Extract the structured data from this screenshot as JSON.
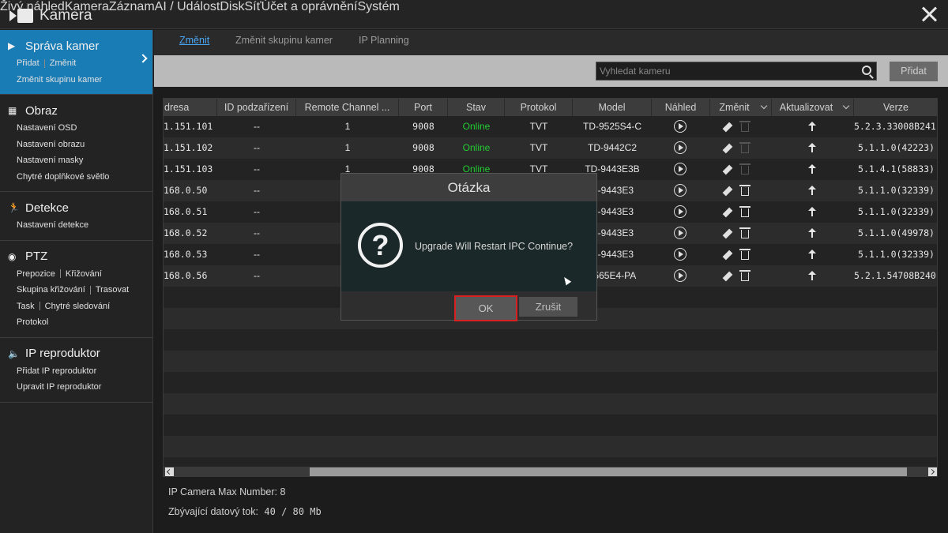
{
  "app": {
    "title": "Kamera"
  },
  "topnav": {
    "items": [
      "Živý náhled",
      "Kamera",
      "Záznam",
      "AI / Událost",
      "Disk",
      "Síť",
      "Účet a oprávnění",
      "Systém"
    ],
    "active_index": 1
  },
  "sidebar": {
    "sections": [
      {
        "title": "Správa kamer",
        "icon": "camera-icon",
        "lines": [
          [
            "Přidat",
            "Změnit"
          ],
          [
            "Změnit skupinu kamer"
          ]
        ]
      },
      {
        "title": "Obraz",
        "icon": "image-icon",
        "lines": [
          [
            "Nastavení OSD"
          ],
          [
            "Nastavení obrazu"
          ],
          [
            "Nastavení masky"
          ],
          [
            "Chytré doplňkové světlo"
          ]
        ]
      },
      {
        "title": "Detekce",
        "icon": "running-person-icon",
        "lines": [
          [
            "Nastavení detekce"
          ]
        ]
      },
      {
        "title": "PTZ",
        "icon": "ptz-dome-icon",
        "lines": [
          [
            "Prepozice",
            "Křižování"
          ],
          [
            "Skupina křižování",
            "Trasovat"
          ],
          [
            "Task",
            "Chytré sledování"
          ],
          [
            "Protokol"
          ]
        ]
      },
      {
        "title": "IP reproduktor",
        "icon": "speaker-icon",
        "lines": [
          [
            "Přidat IP reproduktor"
          ],
          [
            "Upravit IP reproduktor"
          ]
        ]
      }
    ]
  },
  "subtabs": [
    "Změnit",
    "Změnit skupinu kamer",
    "IP Planning"
  ],
  "search": {
    "placeholder": "Vyhledat kameru"
  },
  "add_button": "Přidat",
  "table": {
    "columns": [
      "dresa",
      "ID podzařízení",
      "Remote Channel ...",
      "Port",
      "Stav",
      "Protokol",
      "Model",
      "Náhled",
      "Změnit",
      "Aktualizovat",
      "Verze"
    ],
    "rows": [
      {
        "address": "1.151.101",
        "sub_id": "--",
        "channel": "1",
        "port": "9008",
        "status": "Online",
        "protocol": "TVT",
        "model": "TD-9525S4-C",
        "version": "5.2.3.33008B241...",
        "trash_enabled": false
      },
      {
        "address": "1.151.102",
        "sub_id": "--",
        "channel": "1",
        "port": "9008",
        "status": "Online",
        "protocol": "TVT",
        "model": "TD-9442C2",
        "version": "5.1.1.0(42223)",
        "trash_enabled": false
      },
      {
        "address": "1.151.103",
        "sub_id": "--",
        "channel": "1",
        "port": "9008",
        "status": "Online",
        "protocol": "TVT",
        "model": "TD-9443E3B",
        "version": "5.1.4.1(58833)",
        "trash_enabled": false
      },
      {
        "address": "168.0.50",
        "sub_id": "--",
        "channel": "",
        "port": "",
        "status": "",
        "protocol": "",
        "model": "D-9443E3",
        "version": "5.1.1.0(32339)",
        "trash_enabled": true
      },
      {
        "address": "168.0.51",
        "sub_id": "--",
        "channel": "",
        "port": "",
        "status": "",
        "protocol": "",
        "model": "D-9443E3",
        "version": "5.1.1.0(32339)",
        "trash_enabled": true
      },
      {
        "address": "168.0.52",
        "sub_id": "--",
        "channel": "",
        "port": "",
        "status": "",
        "protocol": "",
        "model": "D-9443E3",
        "version": "5.1.1.0(49978)",
        "trash_enabled": true
      },
      {
        "address": "168.0.53",
        "sub_id": "--",
        "channel": "",
        "port": "",
        "status": "",
        "protocol": "",
        "model": "D-9443E3",
        "version": "5.1.1.0(32339)",
        "trash_enabled": true
      },
      {
        "address": "168.0.56",
        "sub_id": "--",
        "channel": "",
        "port": "",
        "status": "",
        "protocol": "",
        "model": "9565E4-PA",
        "version": "5.2.1.54708B240...",
        "trash_enabled": true
      }
    ]
  },
  "footer": {
    "max_number": "IP Camera Max Number: 8",
    "bitrate_label": "Zbývající datový tok:",
    "bitrate_value": "40 / 80 Mb"
  },
  "dialog": {
    "title": "Otázka",
    "message": "Upgrade Will Restart IPC Continue?",
    "ok": "OK",
    "cancel": "Zrušit"
  },
  "colors": {
    "accent": "#4aa6f2",
    "online": "#22cc33",
    "sidebar_active": "#1a7cb5",
    "highlight": "#d82020"
  }
}
